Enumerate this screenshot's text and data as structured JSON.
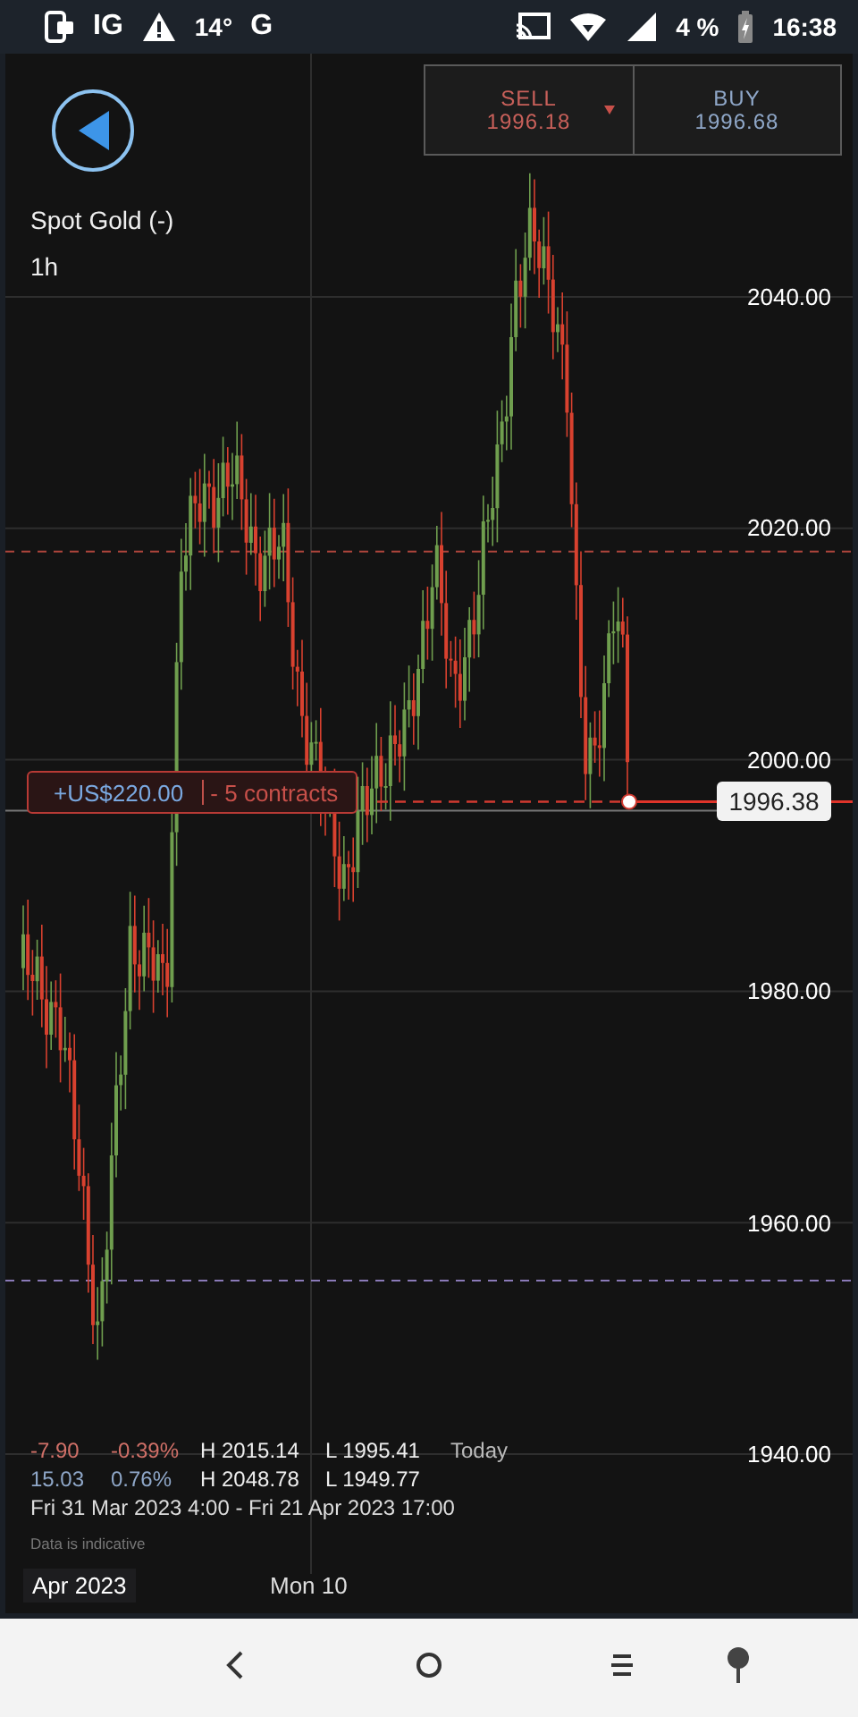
{
  "status_bar": {
    "items": [
      "IG",
      "14°",
      "G"
    ],
    "battery": "4 %",
    "time": "16:38"
  },
  "instrument": {
    "name": "Spot Gold (-)",
    "interval": "1h"
  },
  "deal": {
    "sell": {
      "label": "SELL",
      "price": "1996.18"
    },
    "buy": {
      "label": "BUY",
      "price": "1996.68"
    }
  },
  "position": {
    "pnl": "+US$220.00",
    "size": "- 5 contracts"
  },
  "chart": {
    "y_labels": [
      "2040.00",
      "2020.00",
      "2000.00",
      "1980.00",
      "1960.00",
      "1940.00"
    ],
    "current_price": "1996.38",
    "x_labels": [
      "Apr 2023",
      "Mon 10"
    ]
  },
  "stats": [
    {
      "kind": "down",
      "change": "-7.90",
      "percent": "-0.39%",
      "high": "H 2015.14",
      "low": "L 1995.41",
      "period": "Today"
    },
    {
      "kind": "up",
      "change": "15.03",
      "percent": "0.76%",
      "high": "H 2048.78",
      "low": "L 1949.77"
    }
  ],
  "range": "Fri 31 Mar 2023 4:00 - Fri 21 Apr 2023 17:00",
  "disclaimer": "Data is indicative"
}
